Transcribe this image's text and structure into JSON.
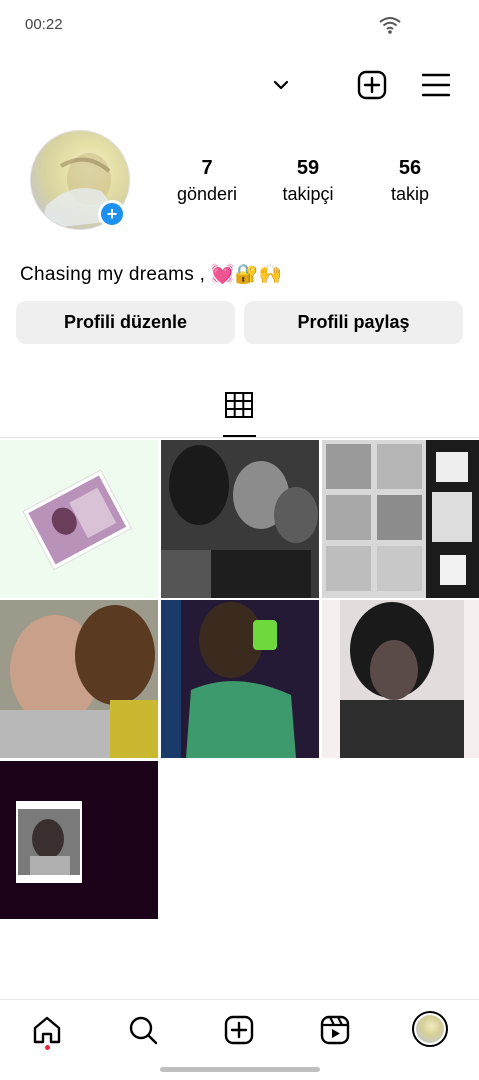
{
  "status_bar": {
    "time": "00:22"
  },
  "profile": {
    "stats": [
      {
        "value": "7",
        "label": "gönderi"
      },
      {
        "value": "59",
        "label": "takipçi"
      },
      {
        "value": "56",
        "label": "takip"
      }
    ],
    "bio": "Chasing my dreams , 💓🔐🙌",
    "edit_label": "Profili düzenle",
    "share_label": "Profili paylaş"
  },
  "icons": {
    "header": [
      "chevron-down-icon",
      "new-post-icon",
      "menu-icon"
    ],
    "tabs": [
      "grid-icon"
    ],
    "bottom_nav": [
      "home-icon",
      "search-icon",
      "create-icon",
      "reels-icon",
      "profile-avatar"
    ]
  },
  "posts_count_shown": 7,
  "colors": {
    "accent_blue": "#1e90f0",
    "button_bg": "#efefef",
    "notification_dot": "#e6253f"
  }
}
